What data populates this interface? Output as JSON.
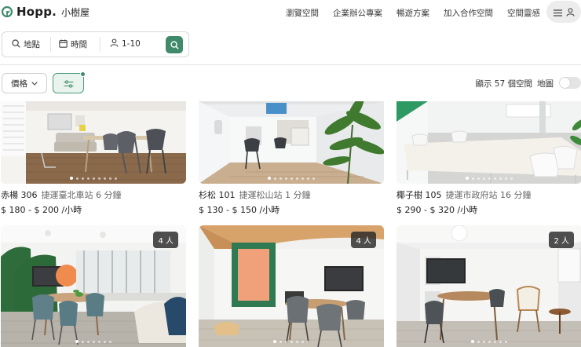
{
  "brand": {
    "name": "Hopp.",
    "subtitle": "小樹屋",
    "accent": "#3f8a6b"
  },
  "nav": [
    "瀏覽空間",
    "企業辦公專案",
    "暢遊方案",
    "加入合作空間",
    "空間靈感"
  ],
  "search": {
    "location": "地點",
    "date": "時間",
    "people": "1-10"
  },
  "filters": {
    "price_label": "價格",
    "result_count": "顯示 57 個空間",
    "map_label": "地圖",
    "map_on": false
  },
  "listings": [
    {
      "name": "赤楊 306",
      "station": "捷運臺北車站 6 分鐘",
      "price": "$ 180 - $ 200 /小時",
      "capacity": ""
    },
    {
      "name": "杉松 101",
      "station": "捷運松山站 1 分鐘",
      "price": "$ 130 - $ 150 /小時",
      "capacity": ""
    },
    {
      "name": "椰子樹 105",
      "station": "捷運市政府站 16 分鐘",
      "price": "$ 290 - $ 320 /小時",
      "capacity": ""
    },
    {
      "name": "",
      "station": "",
      "price": "",
      "capacity": "4 人"
    },
    {
      "name": "",
      "station": "",
      "price": "",
      "capacity": "4 人"
    },
    {
      "name": "",
      "station": "",
      "price": "",
      "capacity": "2 人"
    }
  ]
}
